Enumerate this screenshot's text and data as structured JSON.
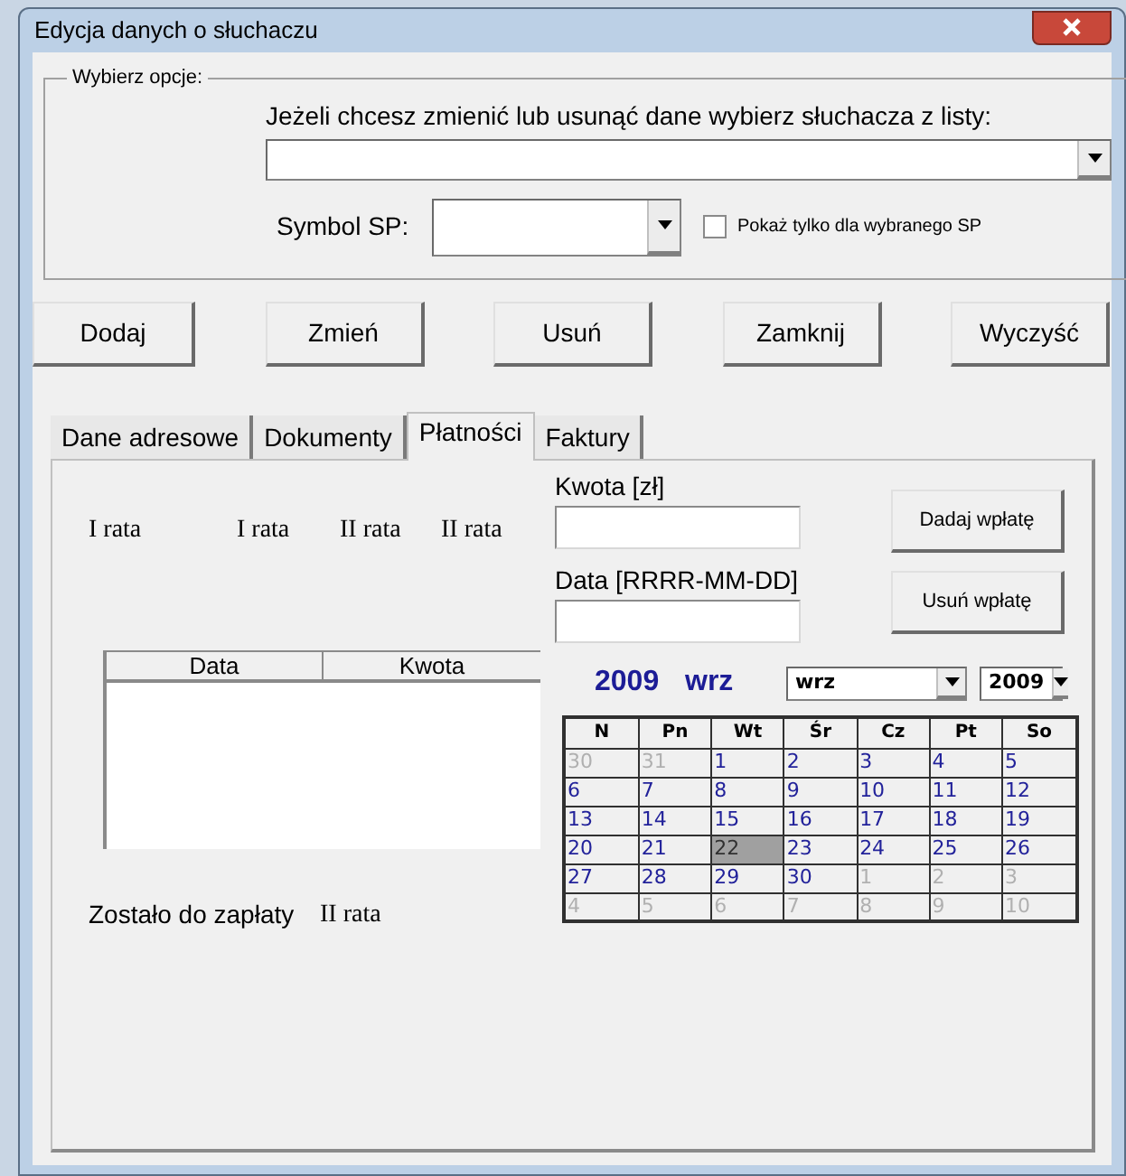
{
  "window": {
    "title": "Edycja danych o słuchaczu"
  },
  "options": {
    "legend": "Wybierz opcje:",
    "prompt": "Jeżeli chcesz zmienić lub usunąć dane wybierz słuchacza z listy:",
    "symbol_label": "Symbol SP:",
    "checkbox": {
      "label": "Pokaż tylko dla wybranego SP",
      "checked": false
    }
  },
  "buttons": [
    "Dodaj",
    "Zmień",
    "Usuń",
    "Zamknij",
    "Wyczyść"
  ],
  "tabs": [
    {
      "label": "Dane adresowe",
      "selected": false
    },
    {
      "label": "Dokumenty",
      "selected": false
    },
    {
      "label": "Płatności",
      "selected": true
    },
    {
      "label": "Faktury",
      "selected": false
    }
  ],
  "payments": {
    "rata_labels": [
      "I rata",
      "I rata",
      "II rata",
      "II rata"
    ],
    "table": {
      "columns": [
        "Data",
        "Kwota"
      ]
    },
    "remaining_label": "Zostało do zapłaty",
    "remaining_value": "II rata",
    "amount_label": "Kwota [zł]",
    "date_label": "Data [RRRR-MM-DD]",
    "actions": [
      "Dadaj wpłatę",
      "Usuń wpłatę"
    ],
    "calendar": {
      "year": "2009",
      "month": "wrz",
      "month_select": "wrz",
      "year_select": "2009",
      "weekdays": [
        "N",
        "Pn",
        "Wt",
        "Śr",
        "Cz",
        "Pt",
        "So"
      ],
      "weeks": [
        [
          {
            "day": "30",
            "in_month": false,
            "selected": false
          },
          {
            "day": "31",
            "in_month": false,
            "selected": false
          },
          {
            "day": "1",
            "in_month": true,
            "selected": false
          },
          {
            "day": "2",
            "in_month": true,
            "selected": false
          },
          {
            "day": "3",
            "in_month": true,
            "selected": false
          },
          {
            "day": "4",
            "in_month": true,
            "selected": false
          },
          {
            "day": "5",
            "in_month": true,
            "selected": false
          }
        ],
        [
          {
            "day": "6",
            "in_month": true,
            "selected": false
          },
          {
            "day": "7",
            "in_month": true,
            "selected": false
          },
          {
            "day": "8",
            "in_month": true,
            "selected": false
          },
          {
            "day": "9",
            "in_month": true,
            "selected": false
          },
          {
            "day": "10",
            "in_month": true,
            "selected": false
          },
          {
            "day": "11",
            "in_month": true,
            "selected": false
          },
          {
            "day": "12",
            "in_month": true,
            "selected": false
          }
        ],
        [
          {
            "day": "13",
            "in_month": true,
            "selected": false
          },
          {
            "day": "14",
            "in_month": true,
            "selected": false
          },
          {
            "day": "15",
            "in_month": true,
            "selected": false
          },
          {
            "day": "16",
            "in_month": true,
            "selected": false
          },
          {
            "day": "17",
            "in_month": true,
            "selected": false
          },
          {
            "day": "18",
            "in_month": true,
            "selected": false
          },
          {
            "day": "19",
            "in_month": true,
            "selected": false
          }
        ],
        [
          {
            "day": "20",
            "in_month": true,
            "selected": false
          },
          {
            "day": "21",
            "in_month": true,
            "selected": false
          },
          {
            "day": "22",
            "in_month": true,
            "selected": true
          },
          {
            "day": "23",
            "in_month": true,
            "selected": false
          },
          {
            "day": "24",
            "in_month": true,
            "selected": false
          },
          {
            "day": "25",
            "in_month": true,
            "selected": false
          },
          {
            "day": "26",
            "in_month": true,
            "selected": false
          }
        ],
        [
          {
            "day": "27",
            "in_month": true,
            "selected": false
          },
          {
            "day": "28",
            "in_month": true,
            "selected": false
          },
          {
            "day": "29",
            "in_month": true,
            "selected": false
          },
          {
            "day": "30",
            "in_month": true,
            "selected": false
          },
          {
            "day": "1",
            "in_month": false,
            "selected": false
          },
          {
            "day": "2",
            "in_month": false,
            "selected": false
          },
          {
            "day": "3",
            "in_month": false,
            "selected": false
          }
        ],
        [
          {
            "day": "4",
            "in_month": false,
            "selected": false
          },
          {
            "day": "5",
            "in_month": false,
            "selected": false
          },
          {
            "day": "6",
            "in_month": false,
            "selected": false
          },
          {
            "day": "7",
            "in_month": false,
            "selected": false
          },
          {
            "day": "8",
            "in_month": false,
            "selected": false
          },
          {
            "day": "9",
            "in_month": false,
            "selected": false
          },
          {
            "day": "10",
            "in_month": false,
            "selected": false
          }
        ]
      ]
    }
  }
}
